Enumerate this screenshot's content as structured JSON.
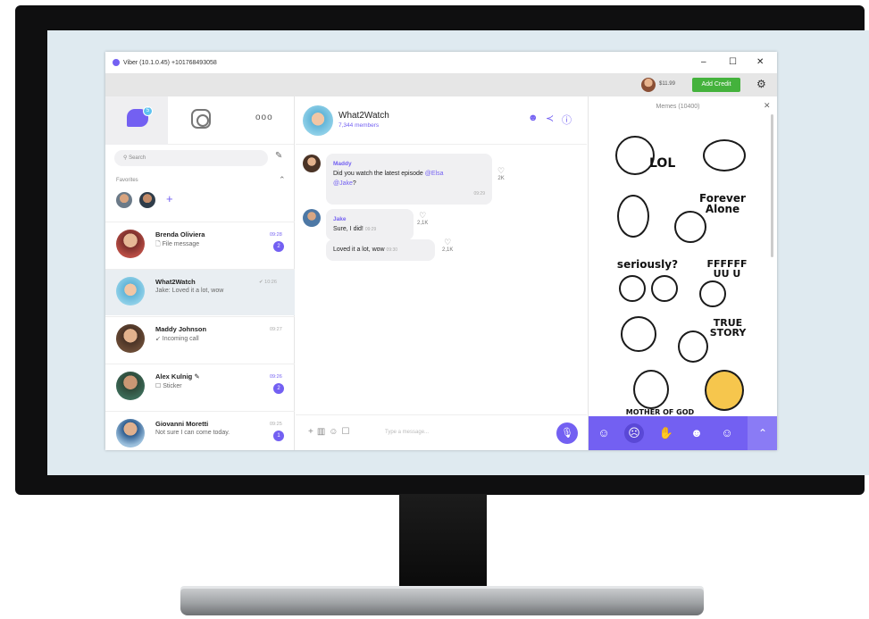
{
  "window": {
    "title": "Viber (10.1.0.45) +101768493058",
    "minimize": "–",
    "maximize": "☐",
    "close": "✕"
  },
  "topbar": {
    "credit": "$11.99",
    "add_credit": "Add Credit",
    "settings_icon": "⚙"
  },
  "left_tabs": {
    "chat_badge": "5",
    "more": "ooo"
  },
  "search": {
    "placeholder": "Search"
  },
  "favorites": {
    "label": "Favorites",
    "add": "+"
  },
  "chats": [
    {
      "name": "Brenda Oliviera",
      "message": "🗋 File message",
      "time": "09:28",
      "badge": "2"
    },
    {
      "name": "What2Watch",
      "message": "Jake: Loved it a lot, wow",
      "time": "✔ 10:26",
      "badge": ""
    },
    {
      "name": "Maddy Johnson",
      "message": "↙ Incoming call",
      "time": "09:27",
      "badge": ""
    },
    {
      "name": "Alex Kulnig ✎",
      "message": "☐ Sticker",
      "time": "09:26",
      "badge": "2"
    },
    {
      "name": "Giovanni Moretti",
      "message": "Not sure I can come today.",
      "time": "09:25",
      "badge": "1"
    }
  ],
  "conversation": {
    "name": "What2Watch",
    "members": "7,344 members",
    "messages": [
      {
        "sender": "Maddy",
        "text_pre": "Did you watch the latest episode ",
        "mention1": "@Elsa",
        "mention2": "@Jake",
        "text_post": "?",
        "time": "09:29",
        "likes": "2K"
      },
      {
        "sender": "Jake",
        "text": "Sure, I did!",
        "time": "09:29",
        "likes": "2,1K"
      },
      {
        "sender": "",
        "text": "Loved it a lot, wow",
        "time": "09:30",
        "likes": "2,1K"
      }
    ],
    "input_placeholder": "Type a message..."
  },
  "stickers": {
    "title": "Memes (10400)",
    "items": [
      {
        "text": "LOL"
      },
      {
        "text": "Forever Alone"
      },
      {
        "text": "seriously?"
      },
      {
        "text": "FFFFFF UU U"
      },
      {
        "text": "TRUE STORY"
      },
      {
        "text": "MOTHER OF GOD"
      }
    ]
  },
  "colors": {
    "accent": "#7360f2",
    "green": "#44b23c"
  }
}
